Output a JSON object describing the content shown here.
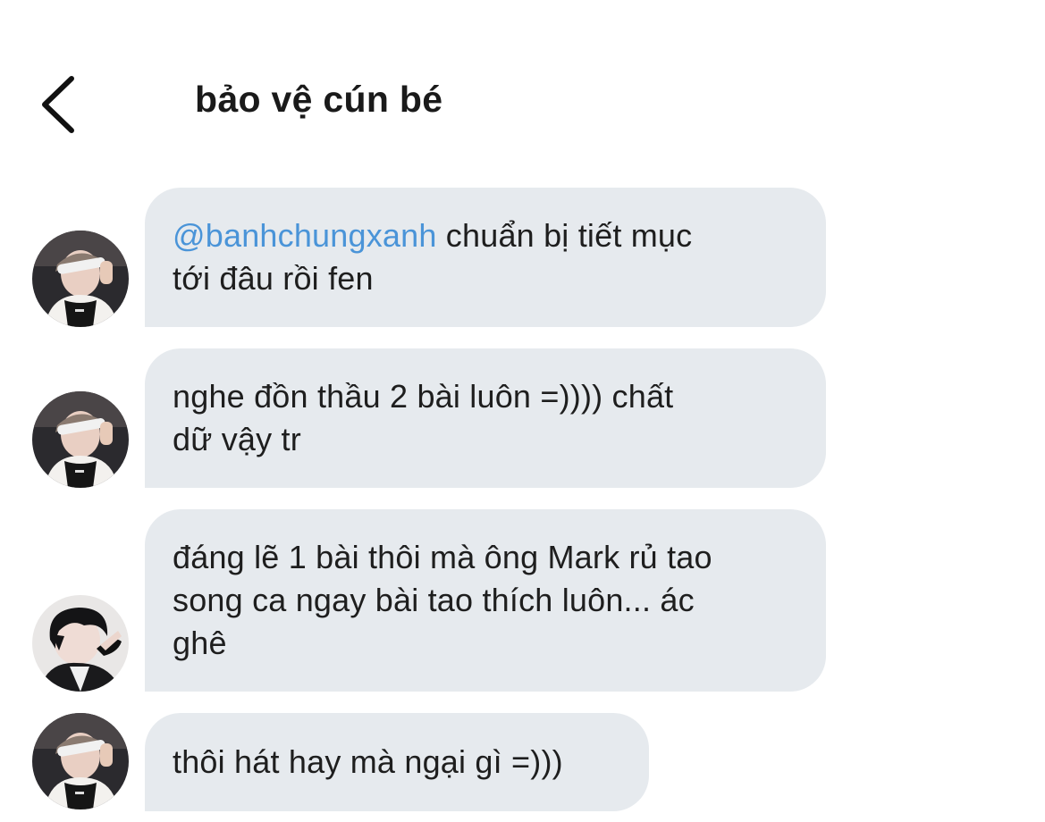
{
  "header": {
    "title": "bảo vệ cún bé",
    "back_icon": "chevron-left-icon"
  },
  "messages": [
    {
      "sender_avatar": "avatar-user-headband",
      "mention": "@banhchungxanh",
      "text_line1": " chuẩn bị tiết mục",
      "text_line2": "tới đâu rồi fen"
    },
    {
      "sender_avatar": "avatar-user-headband",
      "text_line1": "nghe đồn thầu 2 bài luôn =)))) chất",
      "text_line2": "dữ vậy tr"
    },
    {
      "sender_avatar": "avatar-user-dark-hair",
      "text_line1": "đáng lẽ 1 bài thôi mà ông Mark rủ tao",
      "text_line2": "song ca ngay bài tao thích luôn... ác",
      "text_line3": "ghê"
    },
    {
      "sender_avatar": "avatar-user-headband",
      "text_line1": "thôi hát hay mà ngại gì =)))"
    }
  ],
  "colors": {
    "bubble_bg": "#e6eaee",
    "mention": "#4a94d8",
    "text": "#1e1e1e"
  }
}
